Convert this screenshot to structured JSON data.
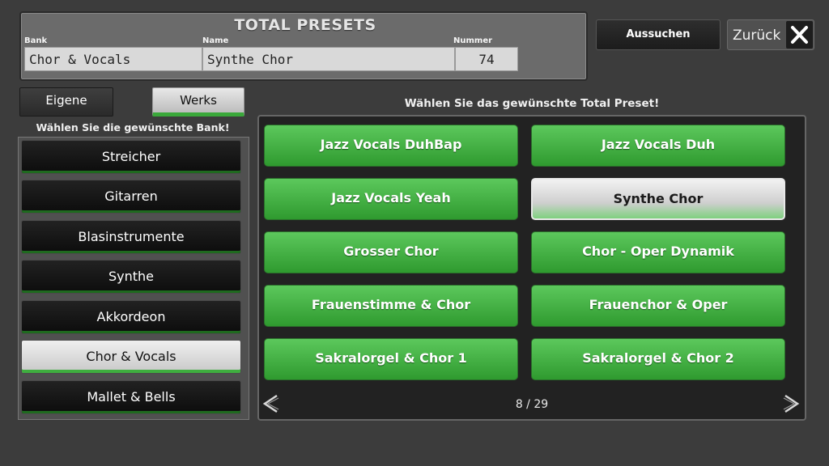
{
  "header": {
    "title": "TOTAL PRESETS",
    "bank_label": "Bank",
    "name_label": "Name",
    "number_label": "Nummer",
    "bank_value": "Chor & Vocals",
    "name_value": "Synthe Chor",
    "number_value": "74"
  },
  "top_buttons": {
    "search_label": "Aussuchen",
    "back_label": "Zurück",
    "close_icon": "close-icon"
  },
  "bank_tabs": {
    "own_label": "Eigene",
    "factory_label": "Werks",
    "active": "Werks"
  },
  "bank_heading": "Wählen Sie die gewünschte Bank!",
  "banks": [
    {
      "label": "Streicher",
      "active": false
    },
    {
      "label": "Gitarren",
      "active": false
    },
    {
      "label": "Blasinstrumente",
      "active": false
    },
    {
      "label": "Synthe",
      "active": false
    },
    {
      "label": "Akkordeon",
      "active": false
    },
    {
      "label": "Chor & Vocals",
      "active": true
    },
    {
      "label": "Mallet & Bells",
      "active": false
    }
  ],
  "preset_heading": "Wählen Sie das gewünschte Total Preset!",
  "presets": [
    {
      "label": "Jazz Vocals DuhBap",
      "selected": false
    },
    {
      "label": "Jazz Vocals Duh",
      "selected": false
    },
    {
      "label": "Jazz Vocals  Yeah",
      "selected": false
    },
    {
      "label": "Synthe Chor",
      "selected": true
    },
    {
      "label": "Grosser Chor",
      "selected": false
    },
    {
      "label": "Chor - Oper  Dynamik",
      "selected": false
    },
    {
      "label": "Frauenstimme & Chor",
      "selected": false
    },
    {
      "label": "Frauenchor & Oper",
      "selected": false
    },
    {
      "label": "Sakralorgel & Chor 1",
      "selected": false
    },
    {
      "label": "Sakralorgel & Chor 2",
      "selected": false
    }
  ],
  "pagination": {
    "text": "8 / 29",
    "prev_icon": "chevron-left-icon",
    "next_icon": "chevron-right-icon"
  },
  "colors": {
    "accent_green": "#3aa83a",
    "background": "#3c3c3c"
  }
}
